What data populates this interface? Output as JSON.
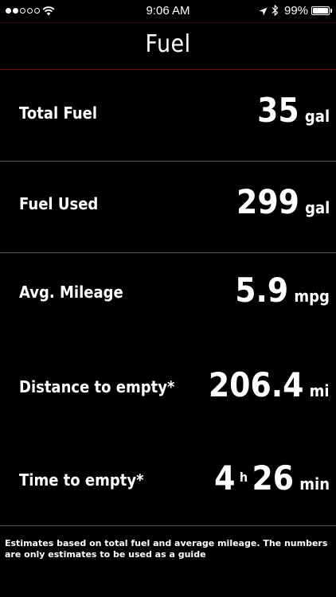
{
  "status_bar": {
    "time": "9:06 AM",
    "battery_percent": "99%",
    "battery_level": 0.99,
    "signal_bars_filled": 2,
    "signal_bars_total": 5
  },
  "header": {
    "title": "Fuel"
  },
  "metrics": {
    "total_fuel": {
      "label": "Total Fuel",
      "value": "35",
      "unit": "gal"
    },
    "fuel_used": {
      "label": "Fuel Used",
      "value": "299",
      "unit": "gal"
    },
    "avg_mileage": {
      "label": "Avg. Mileage",
      "value": "5.9",
      "unit": "mpg"
    },
    "distance_to_empty": {
      "label": "Distance to empty*",
      "value": "206.4",
      "unit": "mi"
    },
    "time_to_empty": {
      "label": "Time to empty*",
      "hours": "4",
      "hours_unit": "h",
      "minutes": "26",
      "minutes_unit": "min"
    }
  },
  "footnote": "Estimates based on total fuel and average mileage. The numbers are only estimates to be used as a guide",
  "colors": {
    "background": "#000000",
    "text": "#ffffff",
    "accent_rule": "#6a1616",
    "divider": "#555555"
  }
}
